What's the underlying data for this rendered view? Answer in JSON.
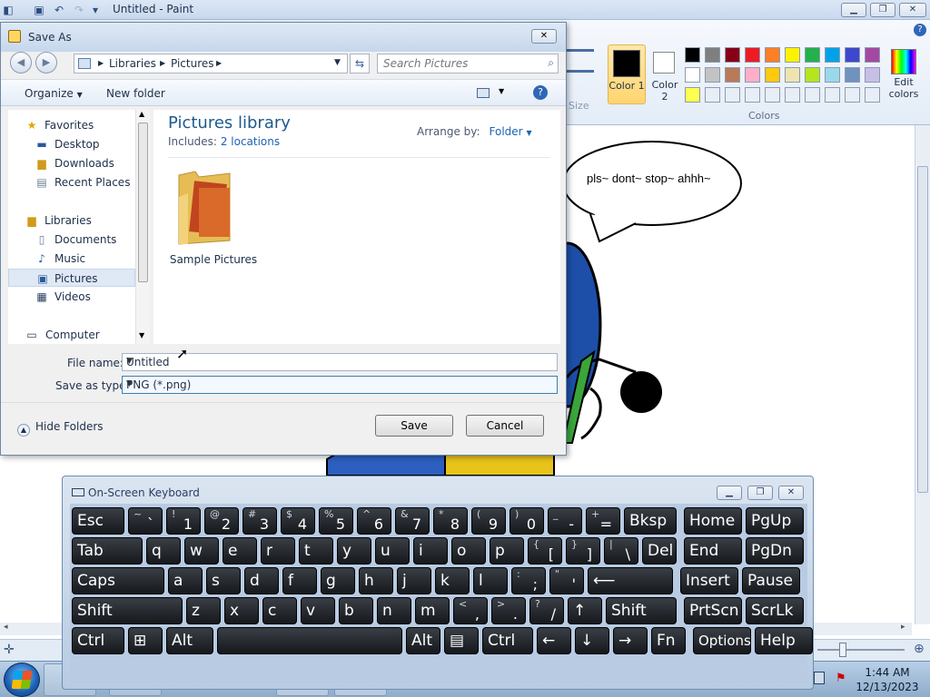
{
  "paint": {
    "title": "Untitled - Paint",
    "size_label": "Size",
    "color1_label": "Color 1",
    "color2_label": "Color 2",
    "edit_colors_label": "Edit colors",
    "colors_group_label": "Colors",
    "speech_text": "pls~ dont~ stop~ ahhh~",
    "palette_row1": [
      "#000000",
      "#7f7f7f",
      "#880015",
      "#ed1c24",
      "#ff7f27",
      "#fff200",
      "#22b14c",
      "#00a2e8",
      "#3f48cc",
      "#a349a4"
    ],
    "palette_row2": [
      "#ffffff",
      "#c3c3c3",
      "#b97a57",
      "#ffaec9",
      "#ffc90e",
      "#efe4b0",
      "#b5e61d",
      "#99d9ea",
      "#7092be",
      "#c8bfe7"
    ],
    "palette_row3": [
      "#ffff4f",
      "#e8eef6",
      "#e8eef6",
      "#e8eef6",
      "#e8eef6",
      "#e8eef6",
      "#e8eef6",
      "#e8eef6",
      "#e8eef6",
      "#e8eef6"
    ]
  },
  "dialog": {
    "title": "Save As",
    "address": [
      "Libraries",
      "Pictures"
    ],
    "search_placeholder": "Search Pictures",
    "organize_label": "Organize",
    "new_folder_label": "New folder",
    "nav": {
      "favorites": "Favorites",
      "desktop": "Desktop",
      "downloads": "Downloads",
      "recent_places": "Recent Places",
      "libraries": "Libraries",
      "documents": "Documents",
      "music": "Music",
      "pictures": "Pictures",
      "videos": "Videos",
      "computer": "Computer"
    },
    "library_title": "Pictures library",
    "includes_label": "Includes:",
    "includes_link": "2 locations",
    "arrange_label": "Arrange by:",
    "arrange_value": "Folder",
    "folder_name": "Sample Pictures",
    "file_name_label": "File name:",
    "file_name_value": "Untitled",
    "save_type_label": "Save as type:",
    "save_type_value": "PNG (*.png)",
    "hide_folders_label": "Hide Folders",
    "save_label": "Save",
    "cancel_label": "Cancel"
  },
  "osk": {
    "title": "On-Screen Keyboard",
    "row1": [
      [
        "Esc",
        ""
      ],
      [
        "~",
        "`"
      ],
      [
        "!",
        "1"
      ],
      [
        "@",
        "2"
      ],
      [
        "#",
        "3"
      ],
      [
        "$",
        "4"
      ],
      [
        "%",
        "5"
      ],
      [
        "^",
        "6"
      ],
      [
        "&",
        "7"
      ],
      [
        "*",
        "8"
      ],
      [
        "(",
        "9"
      ],
      [
        ")",
        "0"
      ],
      [
        "_",
        "-"
      ],
      [
        "+",
        "="
      ],
      [
        "Bksp",
        ""
      ],
      [
        "Home",
        ""
      ],
      [
        "PgUp",
        ""
      ]
    ],
    "row2": [
      [
        "Tab",
        ""
      ],
      [
        "q",
        ""
      ],
      [
        "w",
        ""
      ],
      [
        "e",
        ""
      ],
      [
        "r",
        ""
      ],
      [
        "t",
        ""
      ],
      [
        "y",
        ""
      ],
      [
        "u",
        ""
      ],
      [
        "i",
        ""
      ],
      [
        "o",
        ""
      ],
      [
        "p",
        ""
      ],
      [
        "{",
        "["
      ],
      [
        "}",
        "]"
      ],
      [
        "|",
        "\\"
      ],
      [
        "Del",
        ""
      ],
      [
        "End",
        ""
      ],
      [
        "PgDn",
        ""
      ]
    ],
    "row3": [
      [
        "Caps",
        ""
      ],
      [
        "a",
        ""
      ],
      [
        "s",
        ""
      ],
      [
        "d",
        ""
      ],
      [
        "f",
        ""
      ],
      [
        "g",
        ""
      ],
      [
        "h",
        ""
      ],
      [
        "j",
        ""
      ],
      [
        "k",
        ""
      ],
      [
        "l",
        ""
      ],
      [
        ":",
        ";"
      ],
      [
        "\"",
        "'"
      ],
      [
        "⟵",
        ""
      ],
      [
        "Insert",
        ""
      ],
      [
        "Pause",
        ""
      ]
    ],
    "row4": [
      [
        "Shift",
        ""
      ],
      [
        "z",
        ""
      ],
      [
        "x",
        ""
      ],
      [
        "c",
        ""
      ],
      [
        "v",
        ""
      ],
      [
        "b",
        ""
      ],
      [
        "n",
        ""
      ],
      [
        "m",
        ""
      ],
      [
        "<",
        ","
      ],
      [
        ">",
        "."
      ],
      [
        "?",
        "/"
      ],
      [
        "↑",
        ""
      ],
      [
        "Shift",
        ""
      ],
      [
        "PrtScn",
        ""
      ],
      [
        "ScrLk",
        ""
      ]
    ],
    "row5": [
      [
        "Ctrl",
        ""
      ],
      [
        "⊞",
        ""
      ],
      [
        "Alt",
        ""
      ],
      [
        "",
        ""
      ],
      [
        "Alt",
        ""
      ],
      [
        "▤",
        ""
      ],
      [
        "Ctrl",
        ""
      ],
      [
        "←",
        ""
      ],
      [
        "↓",
        ""
      ],
      [
        "→",
        ""
      ],
      [
        "Fn",
        ""
      ],
      [
        "Options",
        ""
      ],
      [
        "Help",
        ""
      ]
    ]
  },
  "taskbar": {
    "time": "1:44 AM",
    "date": "12/13/2023"
  }
}
